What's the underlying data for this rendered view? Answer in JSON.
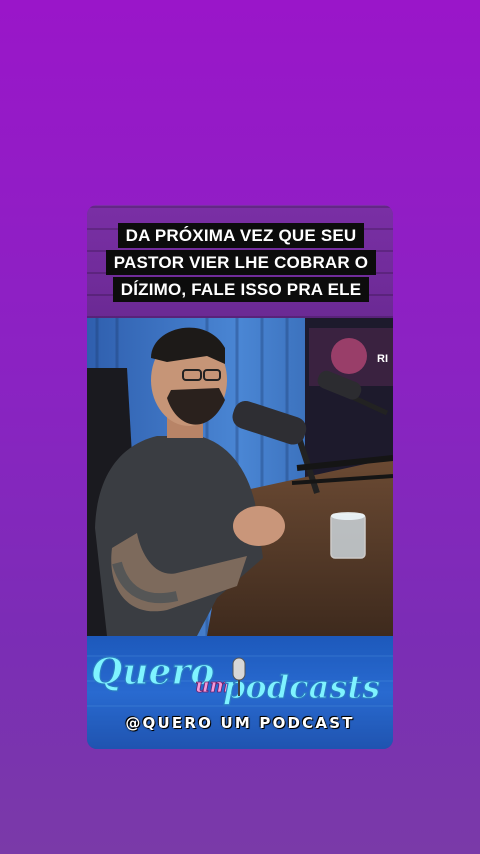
{
  "caption": {
    "text": "DA PRÓXIMA VEZ QUE SEU PASTOR VIER LHE COBRAR O DÍZIMO, FALE ISSO PRA ELE"
  },
  "video": {
    "sign_text": "RI"
  },
  "banner": {
    "logo_word_1": "Quero",
    "logo_word_2": "um",
    "logo_word_3": "podcasts",
    "handle": "@QUERO UM PODCAST"
  },
  "colors": {
    "background_top": "#9a16c9",
    "background_bottom": "#7a3aa8",
    "caption_box": "#0c0c0c",
    "banner_blue": "#2b6fd6",
    "logo_cyan": "#7ff3ff"
  }
}
